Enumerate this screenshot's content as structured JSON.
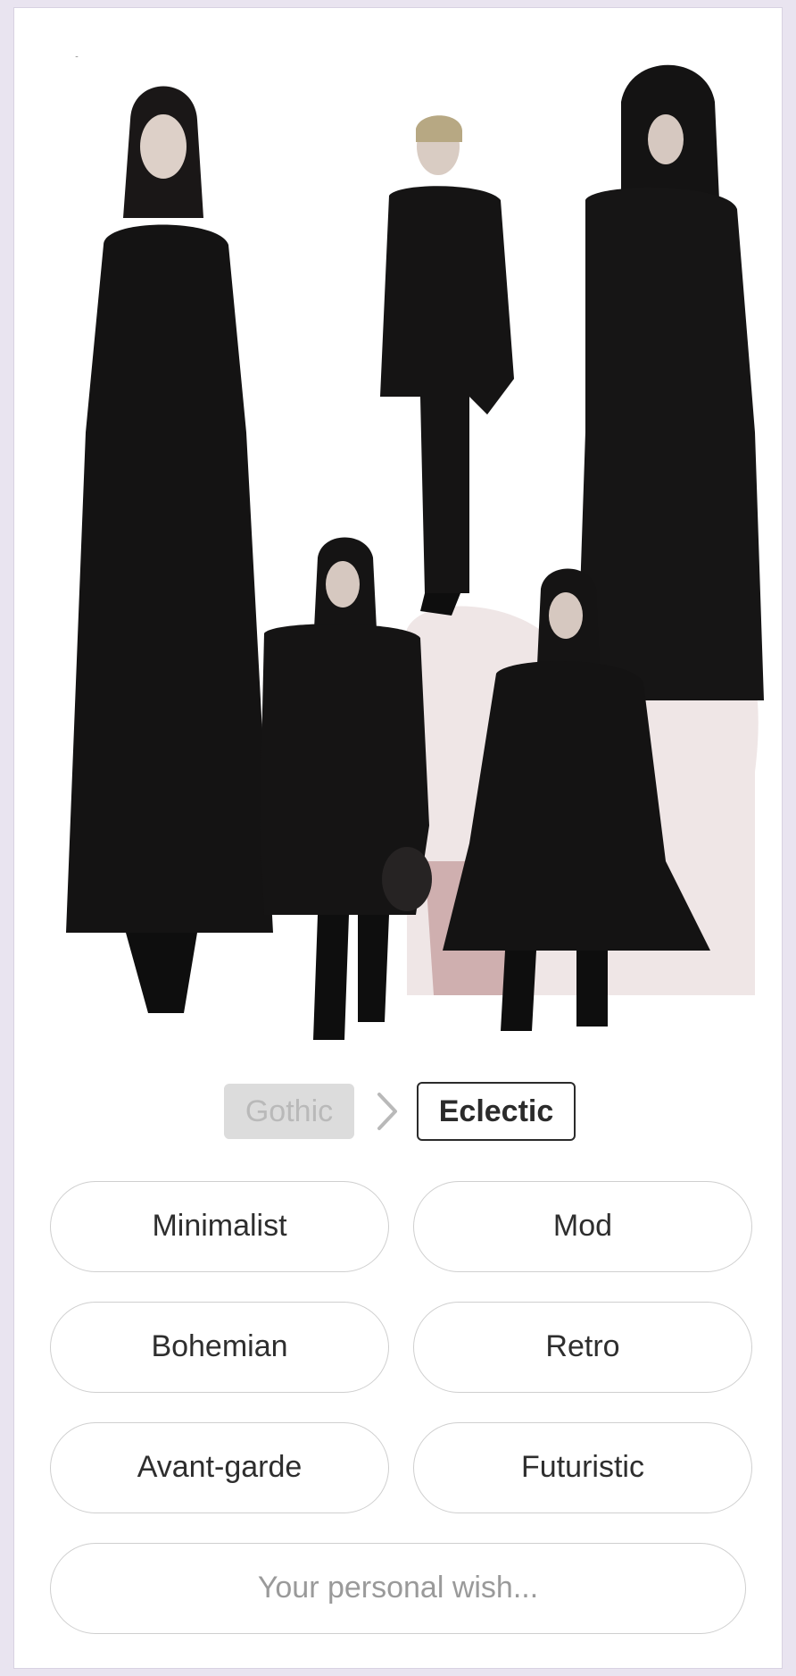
{
  "navigation": {
    "back_icon": "chevron-left-icon",
    "share_icon": "share-icon"
  },
  "image": {
    "description_icon": "photo-placeholder"
  },
  "style_chain": {
    "previous": "Gothic",
    "current": "Eclectic",
    "arrow_icon": "chevron-right-icon"
  },
  "options": [
    {
      "label": "Minimalist"
    },
    {
      "label": "Mod"
    },
    {
      "label": "Bohemian"
    },
    {
      "label": "Retro"
    },
    {
      "label": "Avant-garde"
    },
    {
      "label": "Futuristic"
    }
  ],
  "wish": {
    "placeholder": "Your personal wish..."
  },
  "colors": {
    "page_bg": "#e9e4f0",
    "card_bg": "#ffffff",
    "outline": "#cfcfcf",
    "text": "#2e2e2e",
    "muted": "#9a9a9a"
  }
}
